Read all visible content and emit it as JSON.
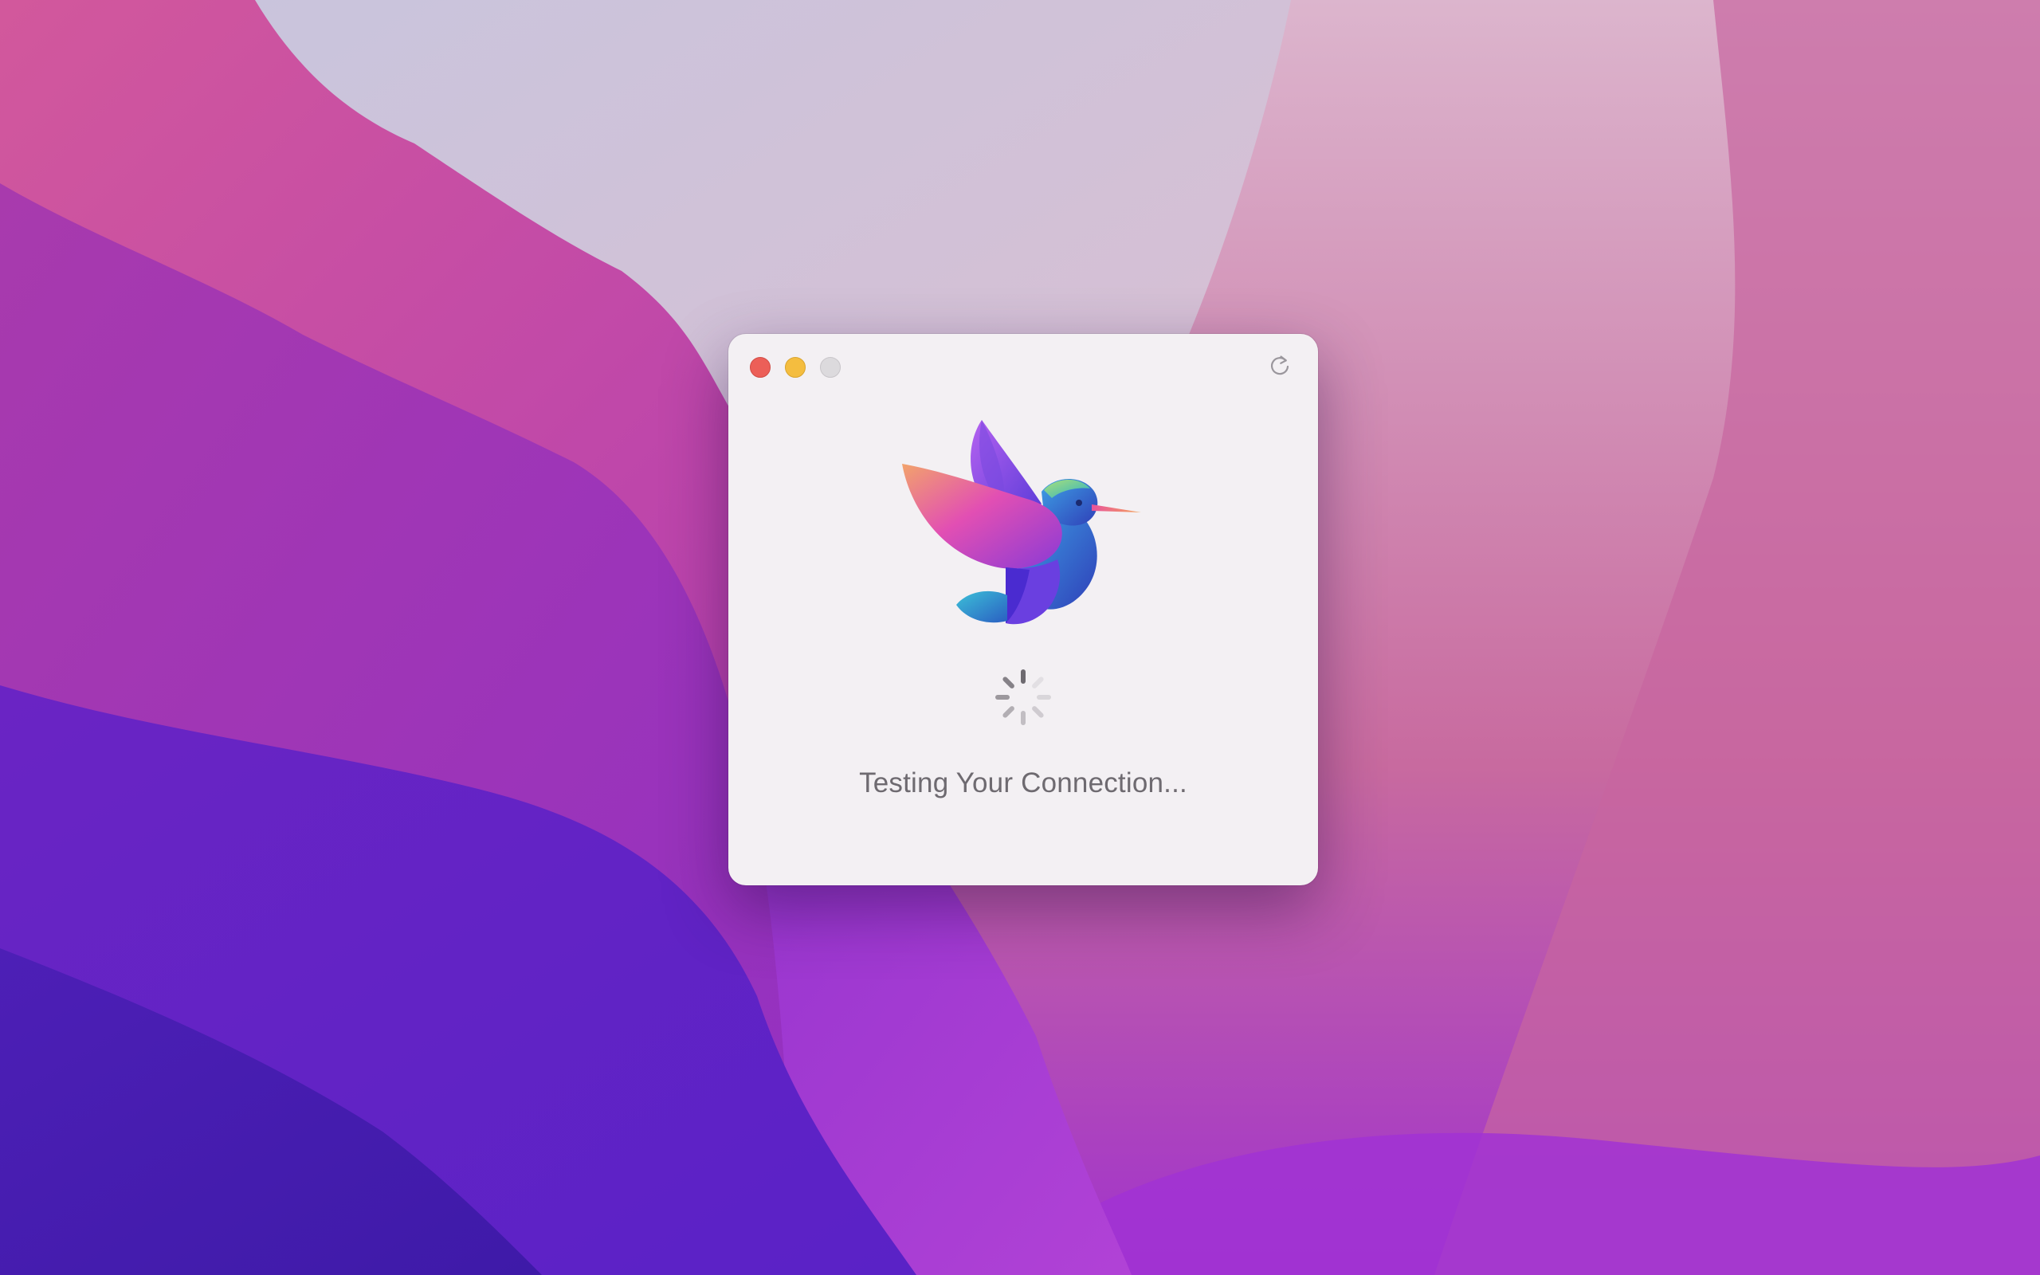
{
  "window": {
    "status_text": "Testing Your Connection..."
  },
  "controls": {
    "close": "close-button",
    "minimize": "minimize-button",
    "zoom": "zoom-button",
    "refresh_icon": "refresh-icon"
  },
  "icons": {
    "logo": "hummingbird-logo-icon",
    "spinner": "loading-spinner-icon"
  },
  "colors": {
    "close": "#ec5f58",
    "minimize": "#f4bd3f",
    "zoom_disabled": "#dcdadd",
    "window_bg": "#f3f0f3",
    "status_text": "#6e6a70"
  }
}
